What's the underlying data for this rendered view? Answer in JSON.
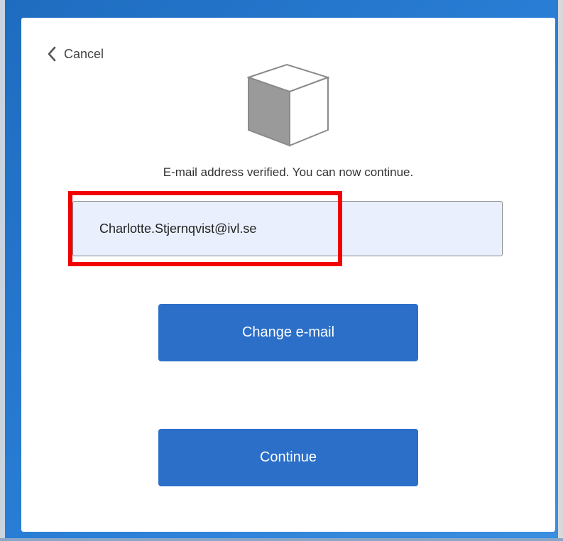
{
  "header": {
    "cancel_label": "Cancel",
    "cancel_icon": "chevron-left-icon",
    "logo_icon": "cube-icon"
  },
  "main": {
    "status_message": "E-mail address verified. You can now continue.",
    "email_field": {
      "value": "Charlotte.Stjernqvist@ivl.se",
      "placeholder": ""
    },
    "change_email_label": "Change e-mail",
    "continue_label": "Continue"
  },
  "colors": {
    "primary_button": "#2b6fc8",
    "input_background": "#e9effc",
    "highlight_annotation": "#f20000",
    "background_blue": "#1e6cc0"
  }
}
